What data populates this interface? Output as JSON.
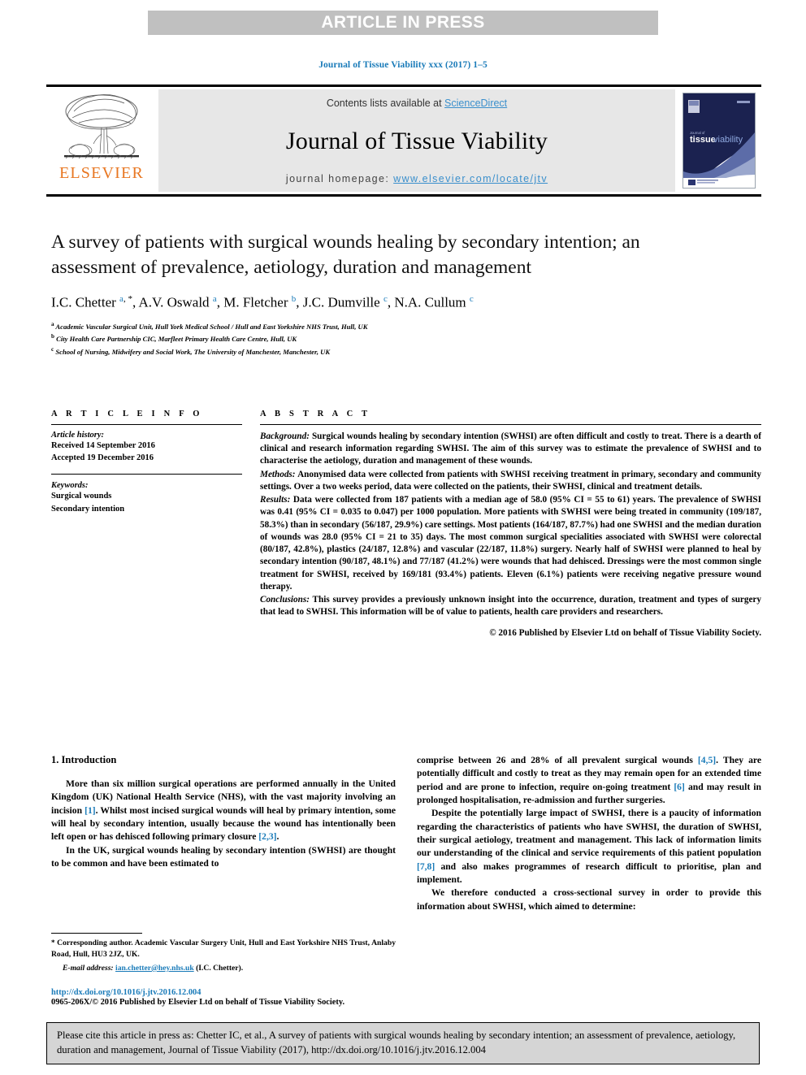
{
  "banner": {
    "label": "ARTICLE IN PRESS"
  },
  "running_head": {
    "text": "Journal of Tissue Viability xxx (2017) 1–5"
  },
  "masthead": {
    "contents_prefix": "Contents lists available at ",
    "contents_link": "ScienceDirect",
    "journal_name": "Journal of Tissue Viability",
    "homepage_prefix": "journal homepage: ",
    "homepage_link": "www.elsevier.com/locate/jtv",
    "publisher_wordmark": "ELSEVIER",
    "cover_title_a": "tissue",
    "cover_title_b": "viability",
    "cover_kicker": "Journal of",
    "icons": {
      "tree": "elsevier-tree-logo",
      "cover": "journal-cover-thumbnail"
    }
  },
  "article": {
    "title": "A survey of patients with surgical wounds healing by secondary intention; an assessment of prevalence, aetiology, duration and management",
    "authors_html": "I.C. Chetter <sup>a, *</sup>, A.V. Oswald <sup>a</sup>, M. Fletcher <sup>b</sup>, J.C. Dumville <sup>c</sup>, N.A. Cullum <sup>c</sup>",
    "affiliations": [
      {
        "marker": "a",
        "text": "Academic Vascular Surgical Unit, Hull York Medical School / Hull and East Yorkshire NHS Trust, Hull, UK"
      },
      {
        "marker": "b",
        "text": "City Health Care Partnership CIC, Marfleet Primary Health Care Centre, Hull, UK"
      },
      {
        "marker": "c",
        "text": "School of Nursing, Midwifery and Social Work, The University of Manchester, Manchester, UK"
      }
    ]
  },
  "article_info": {
    "heading": "A R T I C L E   I N F O",
    "history_label": "Article history:",
    "received": "Received 14 September 2016",
    "accepted": "Accepted 19 December 2016",
    "keywords_label": "Keywords:",
    "keywords": [
      "Surgical wounds",
      "Secondary intention"
    ]
  },
  "abstract": {
    "heading": "A B S T R A C T",
    "background_label": "Background:",
    "background_text": " Surgical wounds healing by secondary intention (SWHSI) are often difficult and costly to treat. There is a dearth of clinical and research information regarding SWHSI. The aim of this survey was to estimate the prevalence of SWHSI and to characterise the aetiology, duration and management of these wounds.",
    "methods_label": "Methods:",
    "methods_text": " Anonymised data were collected from patients with SWHSI receiving treatment in primary, secondary and community settings. Over a two weeks period, data were collected on the patients, their SWHSI, clinical and treatment details.",
    "results_label": "Results:",
    "results_text": " Data were collected from 187 patients with a median age of 58.0 (95% CI = 55 to 61) years. The prevalence of SWHSI was 0.41 (95% CI = 0.035 to 0.047) per 1000 population. More patients with SWHSI were being treated in community (109/187, 58.3%) than in secondary (56/187, 29.9%) care settings. Most patients (164/187, 87.7%) had one SWHSI and the median duration of wounds was 28.0 (95% CI = 21 to 35) days. The most common surgical specialities associated with SWHSI were colorectal (80/187, 42.8%), plastics (24/187, 12.8%) and vascular (22/187, 11.8%) surgery. Nearly half of SWHSI were planned to heal by secondary intention (90/187, 48.1%) and 77/187 (41.2%) were wounds that had dehisced. Dressings were the most common single treatment for SWHSI, received by 169/181 (93.4%) patients. Eleven (6.1%) patients were receiving negative pressure wound therapy.",
    "conclusions_label": "Conclusions:",
    "conclusions_text": " This survey provides a previously unknown insight into the occurrence, duration, treatment and types of surgery that lead to SWHSI. This information will be of value to patients, health care providers and researchers.",
    "copyright": "© 2016 Published by Elsevier Ltd on behalf of Tissue Viability Society."
  },
  "body": {
    "intro_heading": "1. Introduction",
    "left_paragraphs": [
      "More than six million surgical operations are performed annually in the United Kingdom (UK) National Health Service (NHS), with the vast majority involving an incision [1]. Whilst most incised surgical wounds will heal by primary intention, some will heal by secondary intention, usually because the wound has intentionally been left open or has dehisced following primary closure [2,3].",
      "In the UK, surgical wounds healing by secondary intention (SWHSI) are thought to be common and have been estimated to"
    ],
    "right_paragraphs": [
      "comprise between 26 and 28% of all prevalent surgical wounds [4,5]. They are potentially difficult and costly to treat as they may remain open for an extended time period and are prone to infection, require on-going treatment [6] and may result in prolonged hospitalisation, re-admission and further surgeries.",
      "Despite the potentially large impact of SWHSI, there is a paucity of information regarding the characteristics of patients who have SWHSI, the duration of SWHSI, their surgical aetiology, treatment and management. This lack of information limits our understanding of the clinical and service requirements of this patient population [7,8] and also makes programmes of research difficult to prioritise, plan and implement.",
      "We therefore conducted a cross-sectional survey in order to provide this information about SWHSI, which aimed to determine:"
    ]
  },
  "footnote": {
    "corresponding_marker": "*",
    "corresponding_text": " Corresponding author. Academic Vascular Surgery Unit, Hull and East Yorkshire NHS Trust, Anlaby Road, Hull, HU3 2JZ, UK.",
    "email_label": "E-mail address:",
    "email_address": "ian.chetter@hey.nhs.uk",
    "email_owner": "(I.C. Chetter).",
    "doi": "http://dx.doi.org/10.1016/j.jtv.2016.12.004",
    "issn_line": "0965-206X/© 2016 Published by Elsevier Ltd on behalf of Tissue Viability Society."
  },
  "cite_box": {
    "text": "Please cite this article in press as: Chetter IC, et al., A survey of patients with surgical wounds healing by secondary intention; an assessment of prevalence, aetiology, duration and management, Journal of Tissue Viability (2017), http://dx.doi.org/10.1016/j.jtv.2016.12.004"
  },
  "colors": {
    "link_blue": "#1a7bb9",
    "elsevier_orange": "#e87722",
    "banner_gray": "#c0c0c0",
    "masthead_gray": "#e7e7e7",
    "cite_box_gray": "#d5d5d5"
  }
}
